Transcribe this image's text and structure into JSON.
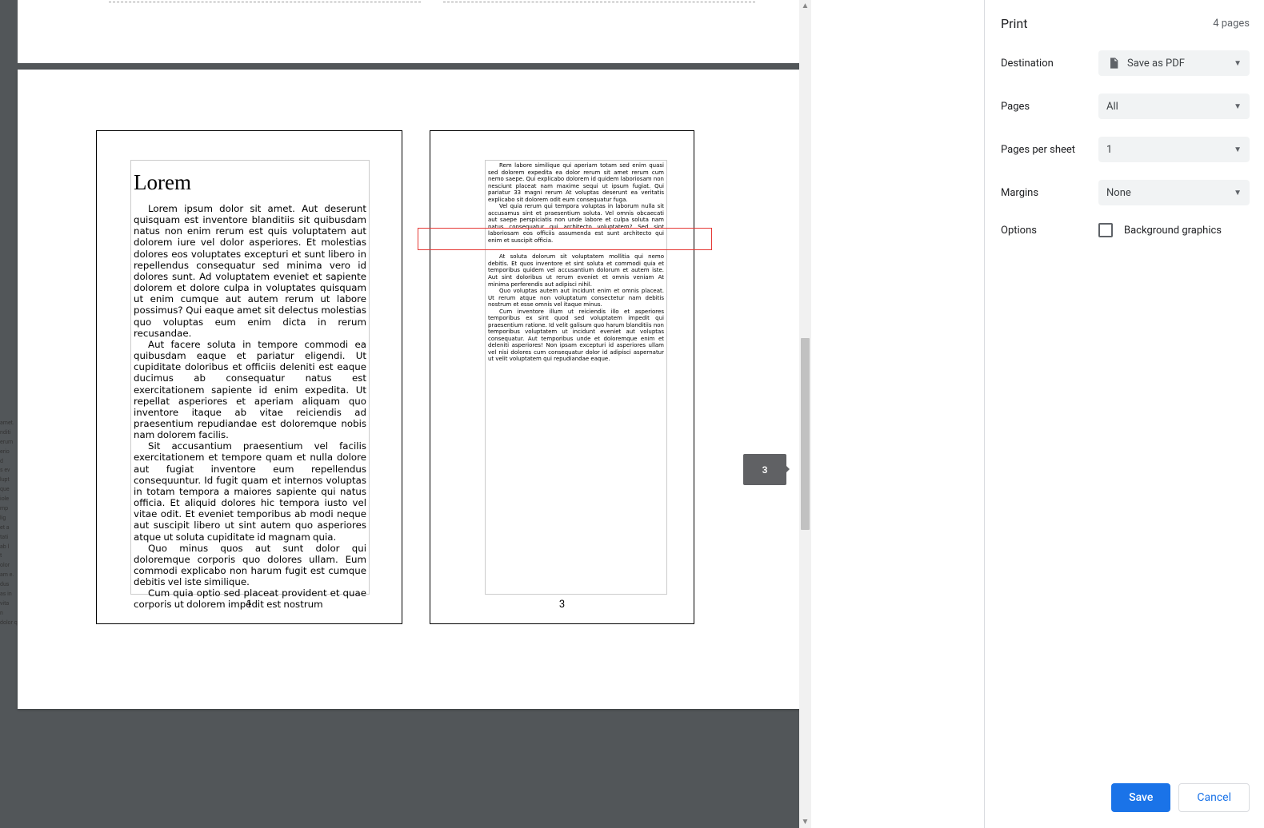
{
  "sidebar": {
    "title": "Print",
    "page_count": "4 pages",
    "rows": {
      "destination": {
        "label": "Destination",
        "value": "Save as PDF"
      },
      "pages": {
        "label": "Pages",
        "value": "All"
      },
      "pps": {
        "label": "Pages per sheet",
        "value": "1"
      },
      "margins": {
        "label": "Margins",
        "value": "None"
      },
      "options": {
        "label": "Options",
        "checkbox_label": "Background graphics"
      }
    },
    "buttons": {
      "save": "Save",
      "cancel": "Cancel"
    }
  },
  "indicator": "3",
  "page1": {
    "num": "1",
    "title": "Lorem",
    "paras": [
      "Lorem ipsum dolor sit amet. Aut deserunt quisquam est inventore blanditiis sit quibusdam natus non enim rerum est quis voluptatem aut dolorem iure vel dolor asperiores. Et molestias dolores eos voluptates excepturi et sunt libero in repellendus consequatur sed minima vero id dolores sunt. Ad voluptatem eveniet et sapiente dolorem et dolore culpa in voluptates quisquam ut enim cumque aut autem rerum ut labore possimus? Qui eaque amet sit delectus molestias quo voluptas eum enim dicta in rerum recusandae.",
      "Aut facere soluta in tempore commodi ea quibusdam eaque et pariatur eligendi. Ut cupiditate doloribus et officiis deleniti est eaque ducimus ab consequatur natus est exercitationem sapiente id enim expedita. Ut repellat asperiores et aperiam aliquam quo inventore itaque ab vitae reiciendis ad praesentium repudiandae est doloremque nobis nam dolorem facilis.",
      "Sit accusantium praesentium vel facilis exercitationem et tempore quam et nulla dolore aut fugiat inventore eum repellendus consequuntur. Id fugit quam et internos voluptas in totam tempora a maiores sapiente qui natus officia. Et aliquid dolores hic tempora iusto vel vitae odit. Et eveniet temporibus ab modi neque aut suscipit libero ut sint autem quo asperiores atque ut soluta cupiditate id magnam quia.",
      "Quo minus quos aut sunt dolor qui doloremque corporis quo dolores ullam. Eum commodi explicabo non harum fugit est cumque debitis vel iste similique.",
      "Cum quia optio sed placeat provident et quae corporis ut dolorem impedit est nostrum"
    ]
  },
  "page3": {
    "num": "3",
    "paras": [
      "Rem labore similique qui aperiam totam sed enim quasi sed dolorem expedita ea dolor rerum sit amet rerum cum nemo saepe. Qui explicabo dolorem id quidem laboriosam non nesciunt placeat nam maxime sequi ut ipsum fugiat. Qui pariatur 33 magni rerum At voluptas deserunt ea veritatis explicabo sit dolorem odit eum consequatur fuga.",
      "Vel quia rerum qui tempora voluptas in laborum nulla sit accusamus sint et praesentium soluta. Vel omnis obcaecati aut saepe perspiciatis non unde labore et culpa soluta nam natus consequatur qui architecto voluptatem? Sed sint laboriosam eos officiis assumenda est sunt architecto qui enim et suscipit officia.",
      "At soluta dolorum sit voluptatem mollitia qui nemo debitis. Et quos inventore et sint soluta et commodi quia et temporibus quidem vel accusantium dolorum et autem iste. Aut sint doloribus ut rerum eveniet et omnis veniam At minima perferendis aut adipisci nihil.",
      "Quo voluptas autem aut incidunt enim et omnis placeat. Ut rerum atque non voluptatum consectetur nam debitis nostrum et esse omnis vel itaque minus.",
      "Cum inventore illum ut reiciendis illo et asperiores temporibus ex sint quod sed voluptatem impedit qui praesentium ratione. Id velit galisum quo harum blanditiis non temporibus voluptatem ut incidunt eveniet aut voluptas consequatur. Aut temporibus unde et doloremque enim et deleniti asperiores! Non ipsam excepturi id asperiores ullam vel nisi dolores cum consequatur dolor id adipisci aspernatur ut velit voluptatem qui repudiandae eaque."
    ]
  },
  "bg_text": "amet.\nnditi\nerum\nerio\nd\ns ev\nlupt\nque\niole\nmp\nlig\net a\ntati\nab l\nt\nolor\nam e.\ndus\nas in\nvita\nn\ndolor qui doloremque"
}
